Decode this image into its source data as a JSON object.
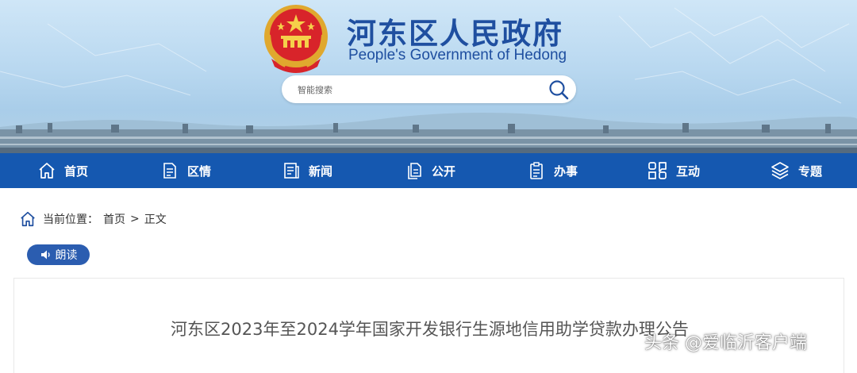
{
  "header": {
    "title": "河东区人民政府",
    "subtitle": "People's Government of Hedong",
    "search_placeholder": "智能搜索"
  },
  "nav": {
    "items": [
      {
        "label": "首页",
        "icon": "home-icon"
      },
      {
        "label": "区情",
        "icon": "document-icon"
      },
      {
        "label": "新闻",
        "icon": "news-icon"
      },
      {
        "label": "公开",
        "icon": "files-icon"
      },
      {
        "label": "办事",
        "icon": "checklist-icon"
      },
      {
        "label": "互动",
        "icon": "interaction-icon"
      },
      {
        "label": "专题",
        "icon": "layers-icon"
      }
    ]
  },
  "breadcrumb": {
    "prefix": "当前位置：",
    "home": "首页",
    "separator": ">",
    "current": "正文"
  },
  "read_aloud": {
    "label": "朗读",
    "icon": "speaker-icon"
  },
  "article": {
    "title": "河东区2023年至2024学年国家开发银行生源地信用助学贷款办理公告"
  },
  "watermark": {
    "text": "头条 @爱临沂客户端"
  },
  "colors": {
    "nav_background": "#1558b0",
    "title_blue": "#1f4fa0",
    "button_blue": "#2b5db0"
  }
}
